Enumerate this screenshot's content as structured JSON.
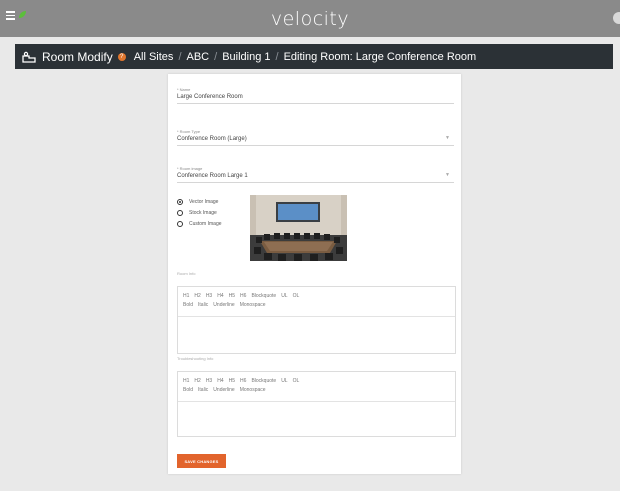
{
  "app": {
    "brand": "velocity"
  },
  "breadcrumb": {
    "title": "Room Modify",
    "items": [
      "All Sites",
      "ABC",
      "Building 1",
      "Editing Room: Large Conference Room"
    ]
  },
  "form": {
    "name": {
      "label": "* Name",
      "value": "Large Conference Room"
    },
    "room_type": {
      "label": "* Room Type",
      "value": "Conference Room (Large)"
    },
    "room_image": {
      "label": "* Room image",
      "value": "Conference Room Large 1"
    },
    "image_options": [
      {
        "label": "Vector Image",
        "selected": true
      },
      {
        "label": "Stock Image",
        "selected": false
      },
      {
        "label": "Custom Image",
        "selected": false
      }
    ],
    "room_info": {
      "label": "Room Info",
      "toolbar_row1": [
        "H1",
        "H2",
        "H3",
        "H4",
        "H5",
        "H6",
        "Blockquote",
        "UL",
        "OL"
      ],
      "toolbar_row2": [
        "Bold",
        "Italic",
        "Underline",
        "Monospace"
      ]
    },
    "troubleshooting_info": {
      "label": "Troubleshooting Info",
      "toolbar_row1": [
        "H1",
        "H2",
        "H3",
        "H4",
        "H5",
        "H6",
        "Blockquote",
        "UL",
        "OL"
      ],
      "toolbar_row2": [
        "Bold",
        "Italic",
        "Underline",
        "Monospace"
      ]
    },
    "save_label": "SAVE CHANGES"
  },
  "colors": {
    "accent": "#e2642c",
    "header": "#8a8a8a",
    "crumbbar": "#2b3136"
  }
}
